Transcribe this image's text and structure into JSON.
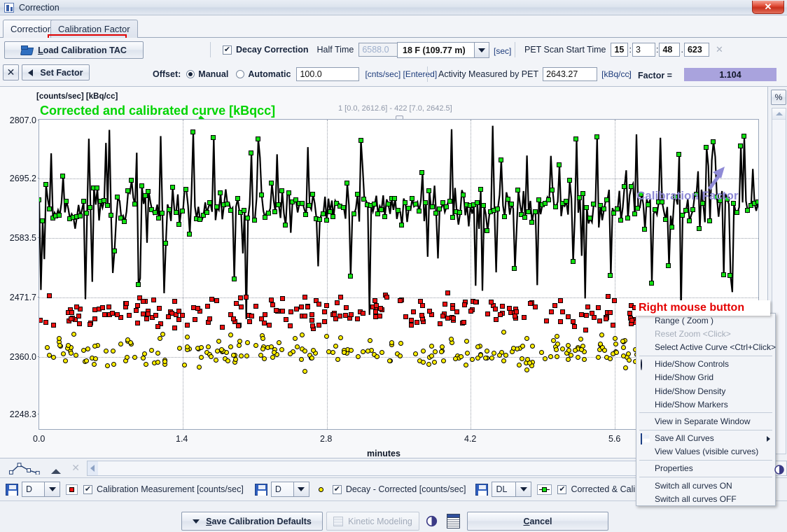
{
  "window": {
    "title": "Correction",
    "close_label": "✕",
    "app_icon": "app-icon"
  },
  "tabs": [
    {
      "id": "correction",
      "label": "Correction",
      "active": false
    },
    {
      "id": "calibration-factor",
      "label": "Calibration Factor",
      "active": true
    }
  ],
  "toolbar": {
    "load_button": "Load Calibration TAC",
    "clear_button": "✕",
    "set_factor_button": "Set Factor",
    "decay_correction_label": "Decay Correction",
    "decay_correction_checked": "✔",
    "half_time_label": "Half Time",
    "half_time_value": "6588.0",
    "isotope_value": "18 F (109.77 m)",
    "half_time_unit": "[sec]",
    "pet_scan_start_label": "PET Scan Start Time",
    "pet_h": "15",
    "pet_m": "3",
    "pet_s": "48",
    "pet_ms": "623",
    "pet_clear": "✕",
    "colon1": ":",
    "colon2": ":",
    "dot": ".",
    "offset_label": "Offset:",
    "manual_label": "Manual",
    "automatic_label": "Automatic",
    "offset_value": "100.0",
    "offset_unit": "[cnts/sec] [Entered]",
    "activity_label": "Activity Measured by PET",
    "activity_value": "2643.27",
    "activity_unit": "[kBq/cc]",
    "factor_label": "Factor =",
    "factor_value": "1.104",
    "factor_color": "#a9a3dd"
  },
  "chart_panel": {
    "axis_units_label": "[counts/sec] [kBq/cc]",
    "annotation_green": "Corrected and calibrated curve [kBqcc]",
    "annotation_green_color": "#00d400",
    "annotation_calfactor": "Calibration Factor",
    "annotation_calfactor_color": "#8f8ad6",
    "info_text": "1 [0.0, 2612.6] - 422 [7.0, 2642.5]",
    "percent_button": "%"
  },
  "chart_data": {
    "type": "scatter",
    "title": "",
    "xlabel": "minutes",
    "ylabel": "[counts/sec] [kBq/cc]",
    "xlim": [
      0.0,
      7.0
    ],
    "ylim": [
      2248.3,
      2807.0
    ],
    "xticks": [
      "0.0",
      "1.4",
      "2.8",
      "4.2",
      "5.6"
    ],
    "xtick_values": [
      0.0,
      1.4,
      2.8,
      4.2,
      5.6
    ],
    "yticks": [
      "2807.0",
      "2695.2",
      "2583.5",
      "2471.7",
      "2360.0",
      "2248.3"
    ],
    "ytick_values": [
      2807.0,
      2695.2,
      2583.5,
      2471.7,
      2360.0,
      2248.3
    ],
    "grid": true,
    "grid_style": "dotted",
    "legend_position": "bottom",
    "point_count": 422,
    "range_first": "1 [0.0, 2612.6]",
    "range_last": "422 [7.0, 2642.5]",
    "series": [
      {
        "name": "Calibration Measurement [counts/sec]",
        "marker": "square",
        "color": "#ee1111",
        "visible": true,
        "mean": 2460,
        "spread": 60,
        "line": false
      },
      {
        "name": "Decay - Corrected [counts/sec]",
        "marker": "circle",
        "color": "#ffee00",
        "visible": true,
        "mean": 2390,
        "spread": 62,
        "line": false
      },
      {
        "name": "Corrected & Calibrated [kBq/cc]",
        "marker": "square",
        "color": "#12e012",
        "visible": true,
        "mean": 2650,
        "spread": 70,
        "line": true,
        "line_color": "#000000"
      }
    ]
  },
  "chart_controls": {
    "curve_icon": "curve-icon",
    "triangle_icon": "triangle-icon",
    "close_icon": "✕",
    "scroll_left": "◀"
  },
  "legend": [
    {
      "save_icon": "save-icon",
      "combo_value": "D",
      "marker": "square-red",
      "checked": "✔",
      "label": "Calibration Measurement [counts/sec]"
    },
    {
      "save_icon": "save-icon",
      "combo_value": "D",
      "marker": "circle-yellow",
      "checked": "✔",
      "label": "Decay - Corrected [counts/sec]"
    },
    {
      "save_icon": "save-icon",
      "combo_value": "DL",
      "marker": "line-green",
      "checked": "✔",
      "label": "Corrected & Calibrated [kBq/cc]"
    }
  ],
  "context_menu": {
    "annotation": "Right mouse button",
    "annotation_color": "#e40000",
    "items": [
      {
        "label": "Range ( Zoom )",
        "disabled": false,
        "icon": null,
        "submenu": false,
        "separator_after": false
      },
      {
        "label": "Reset Zoom <Click>",
        "disabled": true,
        "icon": null,
        "submenu": false,
        "separator_after": false
      },
      {
        "label": "Select Active Curve <Ctrl+Click>",
        "disabled": false,
        "icon": null,
        "submenu": false,
        "separator_after": true
      },
      {
        "label": "Hide/Show Controls",
        "disabled": false,
        "icon": "half-circle-icon",
        "submenu": false,
        "separator_after": false
      },
      {
        "label": "Hide/Show Grid",
        "disabled": false,
        "icon": null,
        "submenu": false,
        "separator_after": false
      },
      {
        "label": "Hide/Show Density",
        "disabled": false,
        "icon": null,
        "submenu": false,
        "separator_after": false
      },
      {
        "label": "Hide/Show Markers",
        "disabled": false,
        "icon": null,
        "submenu": false,
        "separator_after": true
      },
      {
        "label": "View in Separate Window",
        "disabled": false,
        "icon": null,
        "submenu": false,
        "separator_after": true
      },
      {
        "label": "Save All Curves",
        "disabled": false,
        "icon": "save-icon",
        "submenu": true,
        "separator_after": false
      },
      {
        "label": "View Values (visible curves)",
        "disabled": false,
        "icon": null,
        "submenu": false,
        "separator_after": true
      },
      {
        "label": "Properties",
        "disabled": false,
        "icon": null,
        "submenu": false,
        "separator_after": true
      },
      {
        "label": "Switch all curves ON",
        "disabled": false,
        "icon": null,
        "submenu": false,
        "separator_after": false
      },
      {
        "label": "Switch all curves OFF",
        "disabled": false,
        "icon": null,
        "submenu": false,
        "separator_after": false
      }
    ]
  },
  "bottom_bar": {
    "save_defaults": "Save Calibration Defaults",
    "kinetic_modeling": "Kinetic Modeling",
    "cancel": "Cancel"
  }
}
